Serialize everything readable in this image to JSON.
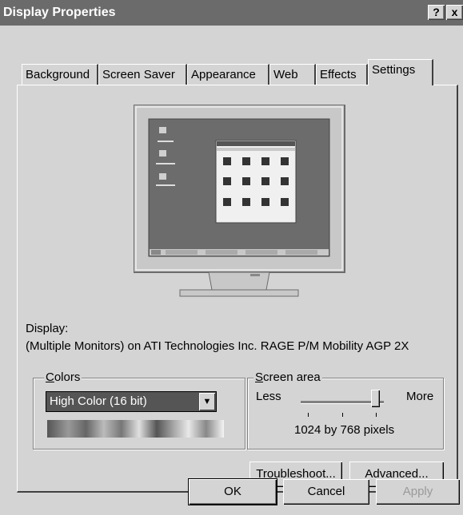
{
  "window": {
    "title": "Display Properties",
    "help": "?",
    "close": "x"
  },
  "tabs": [
    "Background",
    "Screen Saver",
    "Appearance",
    "Web",
    "Effects",
    "Settings"
  ],
  "display": {
    "label": "Display:",
    "value": "(Multiple Monitors) on ATI Technologies Inc. RAGE P/M Mobility AGP 2X"
  },
  "colors": {
    "label": "Colors",
    "selected": "High Color (16 bit)"
  },
  "screen_area": {
    "label": "Screen area",
    "less": "Less",
    "more": "More",
    "resolution": "1024 by 768 pixels",
    "slider_level": 0.9
  },
  "buttons": {
    "troubleshoot": "Troubleshoot...",
    "advanced": "Advanced...",
    "ok": "OK",
    "cancel": "Cancel",
    "apply": "Apply"
  }
}
